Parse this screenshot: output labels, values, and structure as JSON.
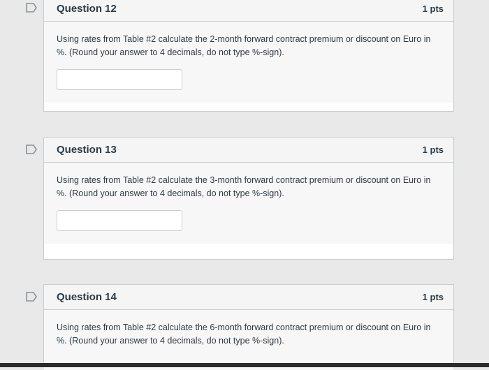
{
  "questions": [
    {
      "title": "Question 12",
      "points": "1 pts",
      "text": "Using rates from Table #2 calculate the 2-month forward contract premium or discount on Euro in %. (Round your answer to 4 decimals, do not type %-sign).",
      "answer_value": ""
    },
    {
      "title": "Question 13",
      "points": "1 pts",
      "text": "Using rates from Table #2 calculate the 3-month forward contract premium or discount on Euro in %. (Round your answer to 4 decimals, do not type %-sign).",
      "answer_value": ""
    },
    {
      "title": "Question 14",
      "points": "1 pts",
      "text": "Using rates from Table #2 calculate the 6-month forward contract premium or discount on Euro in %. (Round your answer to 4 decimals, do not type %-sign).",
      "answer_value": ""
    }
  ],
  "icons": {
    "flag": "flag-question-icon"
  },
  "colors": {
    "flag_stroke": "#8a9297",
    "border": "#c7cdd1",
    "header_bg": "#f5f5f5"
  }
}
